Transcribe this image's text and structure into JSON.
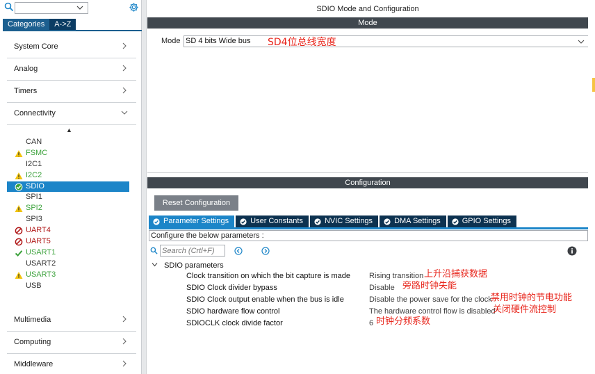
{
  "left_panel": {
    "search_value": "",
    "category_tabs": [
      "Categories",
      "A->Z"
    ],
    "categories_top": [
      "System Core",
      "Analog",
      "Timers",
      "Connectivity"
    ],
    "peripherals": [
      {
        "label": "CAN",
        "status": "none"
      },
      {
        "label": "FSMC",
        "status": "warning"
      },
      {
        "label": "I2C1",
        "status": "none"
      },
      {
        "label": "I2C2",
        "status": "warning"
      },
      {
        "label": "SDIO",
        "status": "selected"
      },
      {
        "label": "SPI1",
        "status": "none"
      },
      {
        "label": "SPI2",
        "status": "warning"
      },
      {
        "label": "SPI3",
        "status": "none"
      },
      {
        "label": "UART4",
        "status": "error"
      },
      {
        "label": "UART5",
        "status": "error"
      },
      {
        "label": "USART1",
        "status": "ok"
      },
      {
        "label": "USART2",
        "status": "none"
      },
      {
        "label": "USART3",
        "status": "warning"
      },
      {
        "label": "USB",
        "status": "none"
      }
    ],
    "categories_bottom": [
      "Multimedia",
      "Computing",
      "Middleware"
    ]
  },
  "header": {
    "title": "SDIO Mode and Configuration"
  },
  "mode": {
    "section_title": "Mode",
    "label": "Mode",
    "value": "SD 4 bits Wide bus",
    "annotation": "SD4位总线宽度"
  },
  "configuration": {
    "section_title": "Configuration",
    "reset_button": "Reset Configuration",
    "tabs": [
      "Parameter Settings",
      "User Constants",
      "NVIC Settings",
      "DMA Settings",
      "GPIO Settings"
    ],
    "configure_text": "Configure the below parameters :",
    "search_placeholder": "Search (Crtl+F)",
    "group_label": "SDIO parameters",
    "params": [
      {
        "name": "Clock transition on which the bit capture is made",
        "value": "Rising transition",
        "note": "上升沿捕获数据"
      },
      {
        "name": "SDIO Clock divider bypass",
        "value": "Disable",
        "note": "旁路时钟失能"
      },
      {
        "name": "SDIO Clock output enable when the bus is idle",
        "value": "Disable the power save for the clock",
        "note": "禁用时钟的节电功能"
      },
      {
        "name": "SDIO hardware flow control",
        "value": "The hardware control flow is disabled",
        "note": "关闭硬件流控制"
      },
      {
        "name": "SDIOCLK clock divide factor",
        "value": "6",
        "note": "时钟分频系数"
      }
    ]
  },
  "colors": {
    "accent": "#1c85c8",
    "dark_tab": "#0d3250",
    "section_header": "#40474e",
    "annotation_red": "#e8261c",
    "warning": "#f1c40f",
    "ok_green": "#3ca23c",
    "error_red": "#b01717"
  }
}
